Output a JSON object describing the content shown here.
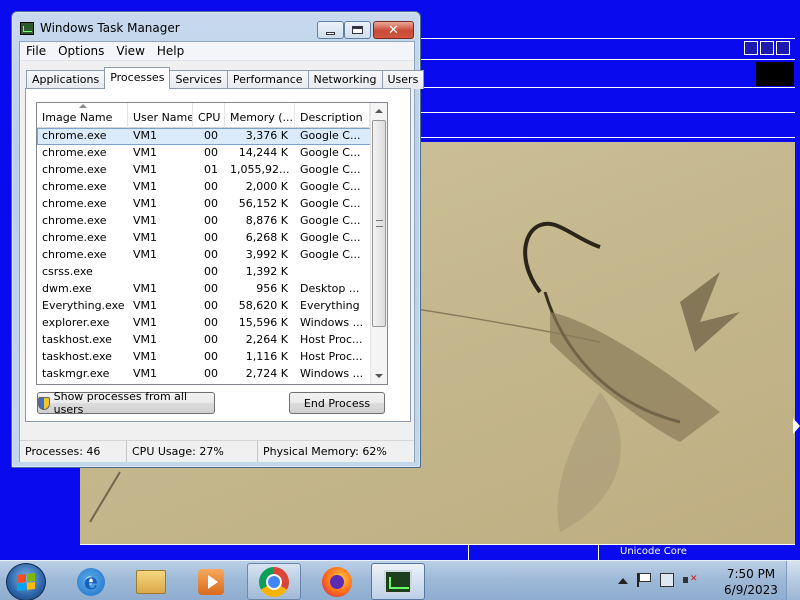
{
  "window": {
    "title": "Windows Task Manager"
  },
  "menu": [
    "File",
    "Options",
    "View",
    "Help"
  ],
  "tabs": [
    "Applications",
    "Processes",
    "Services",
    "Performance",
    "Networking",
    "Users"
  ],
  "active_tab": "Processes",
  "columns": [
    "Image Name",
    "User Name",
    "CPU",
    "Memory (...",
    "Description"
  ],
  "processes": [
    {
      "name": "chrome.exe",
      "user": "VM1",
      "cpu": "00",
      "mem": "3,376 K",
      "desc": "Google C..."
    },
    {
      "name": "chrome.exe",
      "user": "VM1",
      "cpu": "00",
      "mem": "14,244 K",
      "desc": "Google C..."
    },
    {
      "name": "chrome.exe",
      "user": "VM1",
      "cpu": "01",
      "mem": "1,055,92...",
      "desc": "Google C..."
    },
    {
      "name": "chrome.exe",
      "user": "VM1",
      "cpu": "00",
      "mem": "2,000 K",
      "desc": "Google C..."
    },
    {
      "name": "chrome.exe",
      "user": "VM1",
      "cpu": "00",
      "mem": "56,152 K",
      "desc": "Google C..."
    },
    {
      "name": "chrome.exe",
      "user": "VM1",
      "cpu": "00",
      "mem": "8,876 K",
      "desc": "Google C..."
    },
    {
      "name": "chrome.exe",
      "user": "VM1",
      "cpu": "00",
      "mem": "6,268 K",
      "desc": "Google C..."
    },
    {
      "name": "chrome.exe",
      "user": "VM1",
      "cpu": "00",
      "mem": "3,992 K",
      "desc": "Google C..."
    },
    {
      "name": "csrss.exe",
      "user": "",
      "cpu": "00",
      "mem": "1,392 K",
      "desc": ""
    },
    {
      "name": "dwm.exe",
      "user": "VM1",
      "cpu": "00",
      "mem": "956 K",
      "desc": "Desktop ..."
    },
    {
      "name": "Everything.exe",
      "user": "VM1",
      "cpu": "00",
      "mem": "58,620 K",
      "desc": "Everything"
    },
    {
      "name": "explorer.exe",
      "user": "VM1",
      "cpu": "00",
      "mem": "15,596 K",
      "desc": "Windows ..."
    },
    {
      "name": "taskhost.exe",
      "user": "VM1",
      "cpu": "00",
      "mem": "2,264 K",
      "desc": "Host Proc..."
    },
    {
      "name": "taskhost.exe",
      "user": "VM1",
      "cpu": "00",
      "mem": "1,116 K",
      "desc": "Host Proc..."
    },
    {
      "name": "taskmgr.exe",
      "user": "VM1",
      "cpu": "00",
      "mem": "2,724 K",
      "desc": "Windows ..."
    }
  ],
  "buttons": {
    "show_all": "Show processes from all users",
    "end_process": "End Process"
  },
  "status": {
    "processes": "Processes: 46",
    "cpu": "CPU Usage: 27%",
    "memory": "Physical Memory: 62%"
  },
  "background_status": "Unicode Core",
  "taskbar": {
    "items": [
      "internet-explorer",
      "windows-explorer",
      "media-player",
      "google-chrome",
      "firefox",
      "task-manager"
    ],
    "time": "7:50 PM",
    "date": "6/9/2023"
  },
  "colors": {
    "accent_blue": "#0a0aee",
    "selection": "#dcebfc"
  }
}
